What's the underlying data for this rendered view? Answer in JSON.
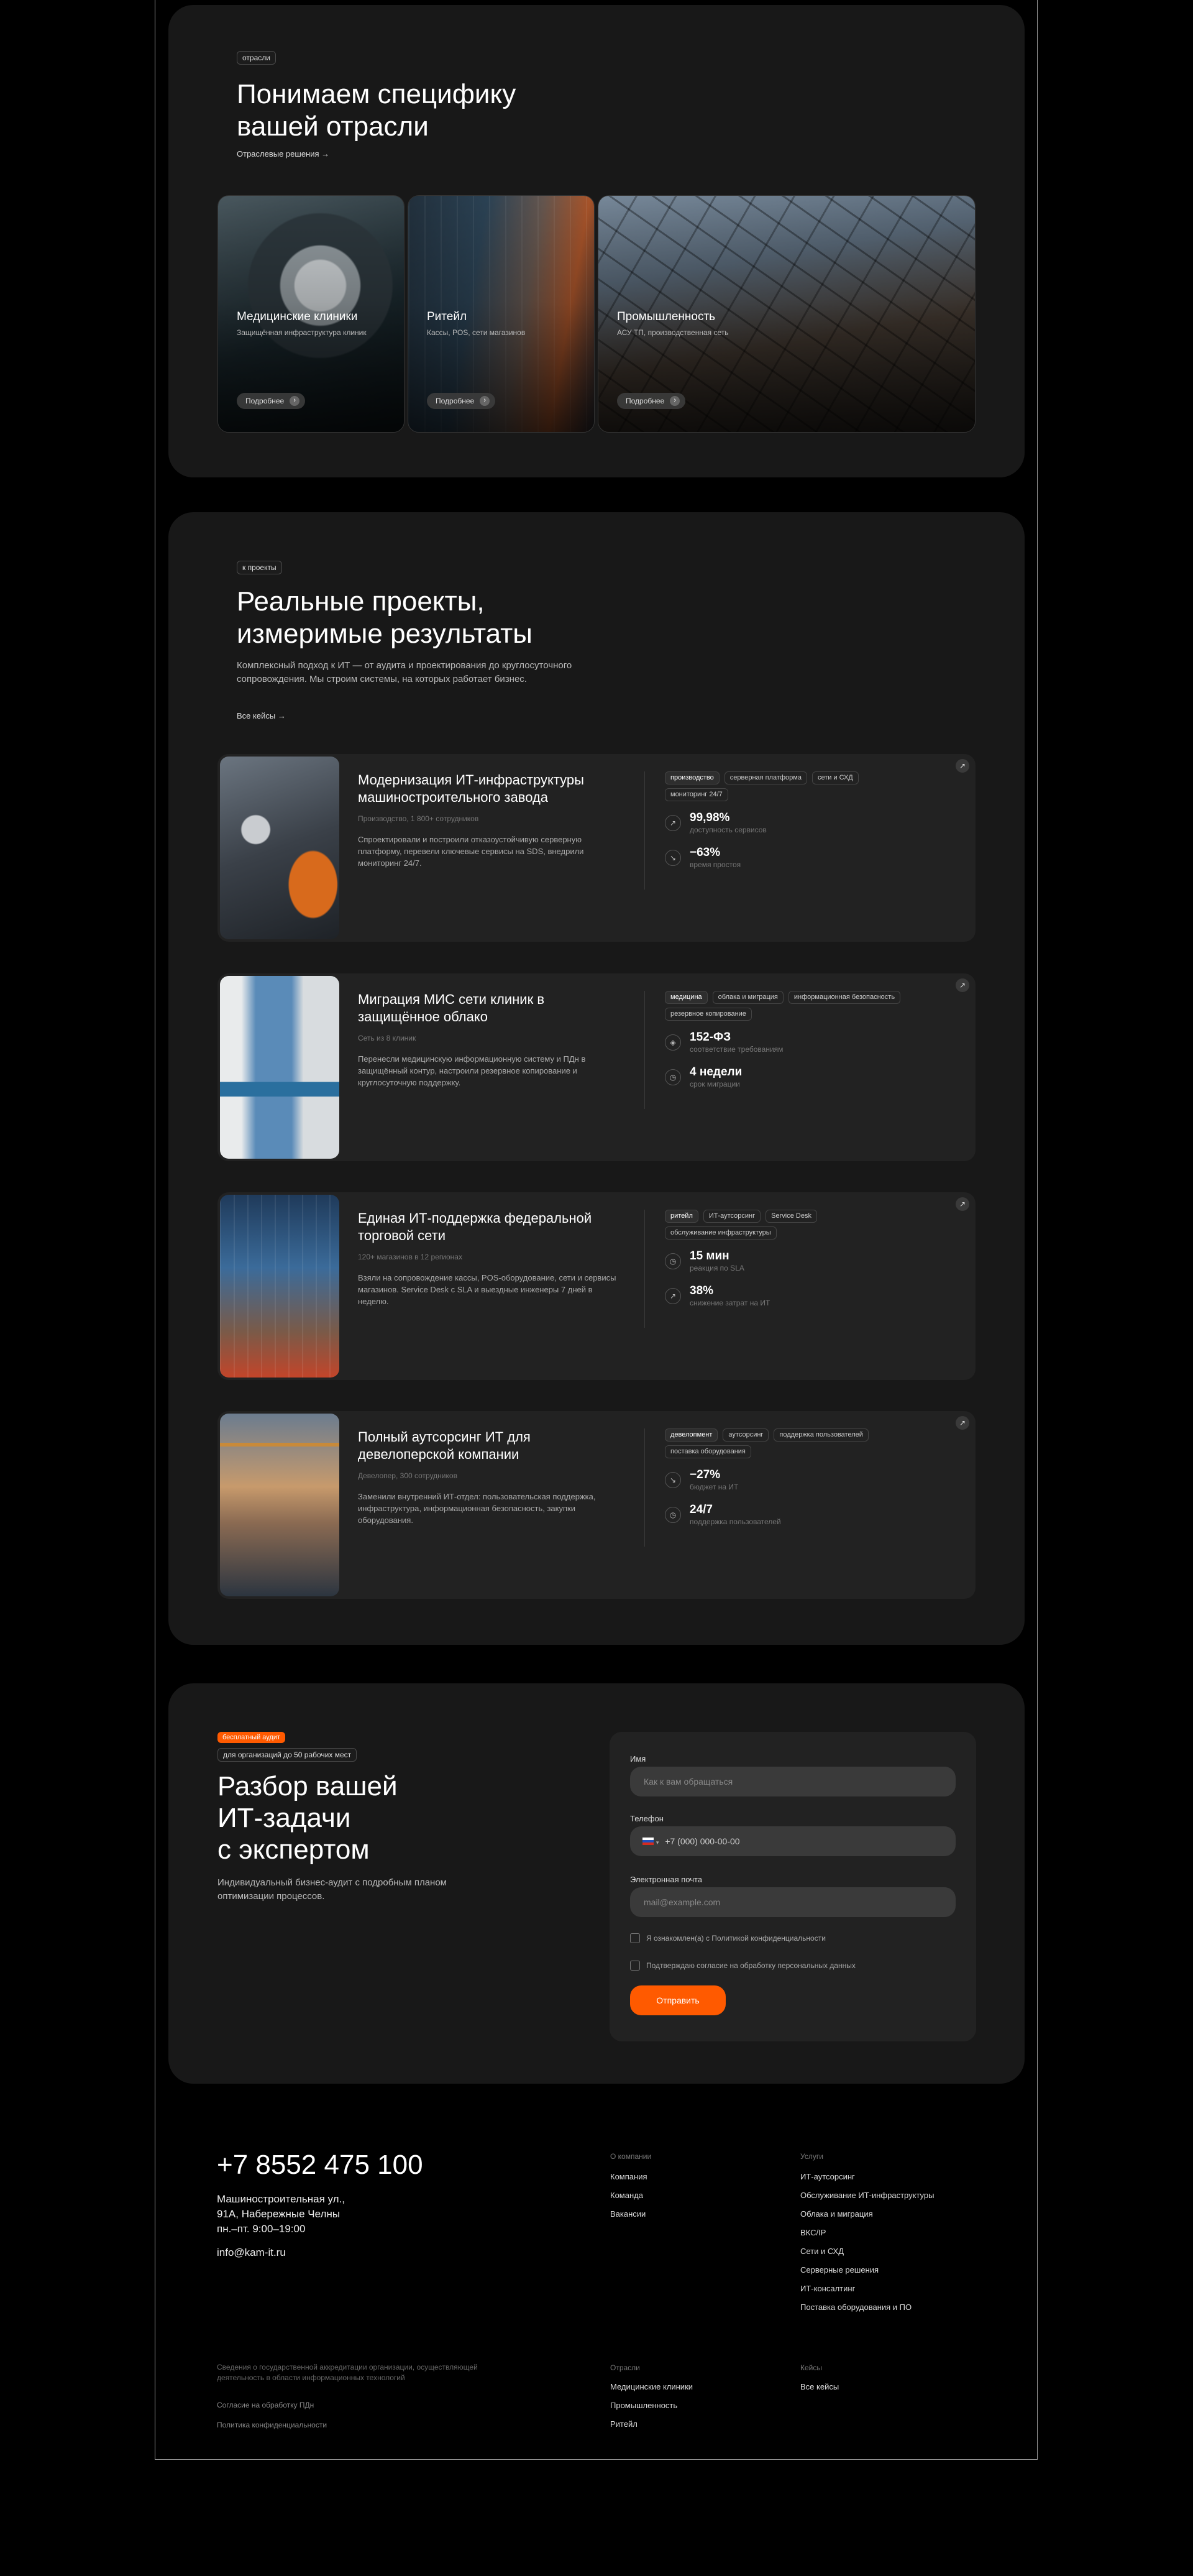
{
  "colors": {
    "accent": "#ff5a00",
    "section_bg": "#181818",
    "card_bg": "#222222"
  },
  "industries": {
    "tag": "отрасли",
    "title_line1": "Понимаем специфику",
    "title_line2": "вашей отрасли",
    "link": "Отраслевые решения",
    "cards": [
      {
        "title": "Медицинские клиники",
        "desc": "Защищённая инфраструктура клиник",
        "button": "Подробнее"
      },
      {
        "title": "Ритейл",
        "desc": "Кассы, POS, сети магазинов",
        "button": "Подробнее"
      },
      {
        "title": "Промышленность",
        "desc": "АСУ ТП, производственная сеть",
        "button": "Подробнее"
      }
    ]
  },
  "projects": {
    "tag": "к проекты",
    "title_line1": "Реальные проекты,",
    "title_line2": "измеримые результаты",
    "desc": "Комплексный подход к ИТ — от аудита и проектирования до круглосуточного сопровождения. Мы строим системы, на которых работает бизнес.",
    "link": "Все кейсы",
    "items": [
      {
        "title": "Модернизация ИТ-инфраструктуры машиностроительного завода",
        "sub": "Производство, 1 800+ сотрудников",
        "desc": "Спроектировали и построили отказоустойчивую серверную платформу, перевели ключевые сервисы на SDS, внедрили мониторинг 24/7.",
        "tags": [
          "производство",
          "серверная платформа",
          "сети и СХД",
          "мониторинг 24/7"
        ],
        "metrics": [
          {
            "icon": "chart-up-icon",
            "value": "99,98%",
            "label": "доступность сервисов"
          },
          {
            "icon": "chart-down-icon",
            "value": "−63%",
            "label": "время простоя"
          }
        ]
      },
      {
        "title": "Миграция МИС сети клиник в защищённое облако",
        "sub": "Сеть из 8 клиник",
        "desc": "Перенесли медицинскую информационную систему и ПДн в защищённый контур, настроили резервное копирование и круглосуточную поддержку.",
        "tags": [
          "медицина",
          "облака и миграция",
          "информационная безопасность",
          "резервное копирование"
        ],
        "metrics": [
          {
            "icon": "shield-icon",
            "value": "152-ФЗ",
            "label": "соответствие требованиям"
          },
          {
            "icon": "clock-icon",
            "value": "4 недели",
            "label": "срок миграции"
          }
        ]
      },
      {
        "title": "Единая ИТ-поддержка федеральной торговой сети",
        "sub": "120+ магазинов в 12 регионах",
        "desc": "Взяли на сопровождение кассы, POS-оборудование, сети и сервисы магазинов. Service Desk с SLA и выездные инженеры 7 дней в неделю.",
        "tags": [
          "ритейл",
          "ИТ-аутсорсинг",
          "Service Desk",
          "обслуживание инфраструктуры"
        ],
        "metrics": [
          {
            "icon": "clock-icon",
            "value": "15 мин",
            "label": "реакция по SLA"
          },
          {
            "icon": "chart-up-icon",
            "value": "38%",
            "label": "снижение затрат на ИТ"
          }
        ]
      },
      {
        "title": "Полный аутсорсинг ИТ для девелоперской компании",
        "sub": "Девелопер, 300 сотрудников",
        "desc": "Заменили внутренний ИТ-отдел: пользовательская поддержка, инфраструктура, информационная безопасность, закупки оборудования.",
        "tags": [
          "девелопмент",
          "аутсорсинг",
          "поддержка пользователей",
          "поставка оборудования"
        ],
        "metrics": [
          {
            "icon": "chart-down-icon",
            "value": "−27%",
            "label": "бюджет на ИТ"
          },
          {
            "icon": "clock-icon",
            "value": "24/7",
            "label": "поддержка пользователей"
          }
        ]
      }
    ]
  },
  "audit": {
    "badge": "бесплатный аудит",
    "note": "для организаций до 50 рабочих мест",
    "title_line1": "Разбор вашей",
    "title_line2": "ИТ-задачи",
    "title_line3": "с экспертом",
    "desc": "Индивидуальный бизнес-аудит с подробным планом оптимизации процессов.",
    "form": {
      "name_label": "Имя",
      "name_placeholder": "Как к вам обращаться",
      "phone_label": "Телефон",
      "phone_placeholder": "+7 (000) 000-00-00",
      "email_label": "Электронная почта",
      "email_placeholder": "mail@example.com",
      "consent1": "Я ознакомлен(а) с Политикой конфиденциальности",
      "consent2": "Подтверждаю согласие на обработку персональных данных",
      "submit": "Отправить"
    }
  },
  "footer": {
    "phone": "+7 8552 475 100",
    "address_line1": "Машиностроительная ул.,",
    "address_line2": "91А, Набережные Челны",
    "hours": "пн.–пт. 9:00–19:00",
    "email": "info@kam-it.ru",
    "company_heading": "О компании",
    "company_links": [
      "Компания",
      "Команда",
      "Вакансии"
    ],
    "services_heading": "Услуги",
    "services_links": [
      "ИТ-аутсорсинг",
      "Обслуживание ИТ-инфраструктуры",
      "Облака и миграция",
      "ВКС/IP",
      "Сети и СХД",
      "Серверные решения",
      "ИТ-консалтинг",
      "Поставка оборудования и ПО"
    ],
    "legal_text": "Сведения о государственной аккредитации организации, осуществляющей деятельность в области информационных технологий",
    "legal_link1": "Согласие на обработку ПДн",
    "legal_link2": "Политика конфиденциальности",
    "industries_heading": "Отрасли",
    "industries_links": [
      "Медицинские клиники",
      "Промышленность",
      "Ритейл"
    ],
    "cases_heading": "Кейсы",
    "cases_links": [
      "Все кейсы"
    ]
  }
}
